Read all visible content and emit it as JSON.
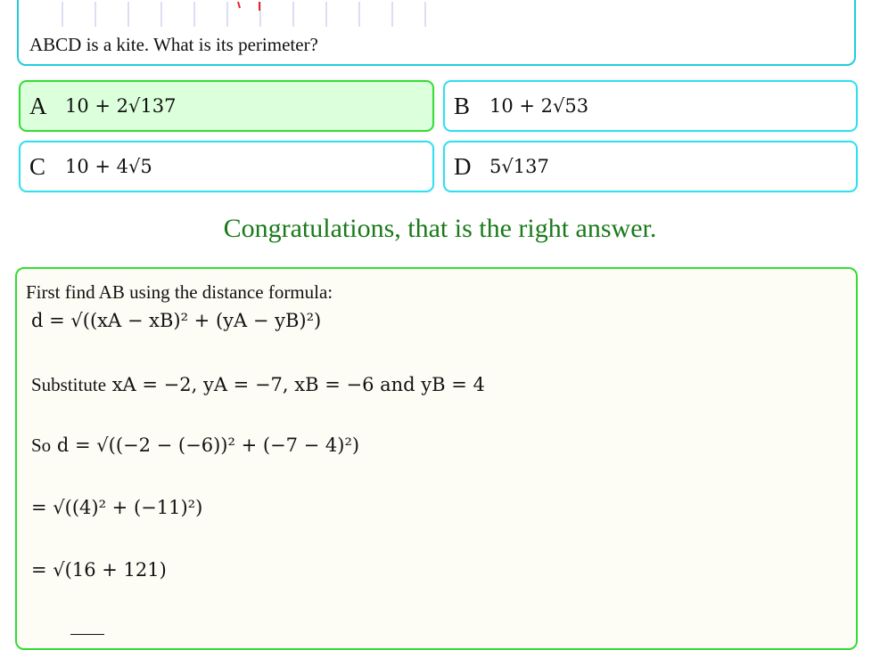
{
  "question": {
    "text": "ABCD is a kite. What is its perimeter?"
  },
  "options": [
    {
      "letter": "A",
      "value": "10 + 2√137",
      "state": "correct"
    },
    {
      "letter": "B",
      "value": "10 + 2√53",
      "state": "normal"
    },
    {
      "letter": "C",
      "value": "10 + 4√5",
      "state": "normal"
    },
    {
      "letter": "D",
      "value": "5√137",
      "state": "normal"
    }
  ],
  "feedback": "Congratulations, that is the right answer.",
  "solution": {
    "intro": "First find AB using the distance formula:",
    "distance_formula": "d = √((xA − xB)² + (yA − yB)²)",
    "substitute_word": "Substitute",
    "substitute": "xA = −2, yA = −7, xB = −6 and yB = 4",
    "so_word": "So",
    "step1": "d = √((−2 − (−6))² + (−7 − 4)²)",
    "step2": "= √((4)² + (−11)²)",
    "step3": "= √(16 + 121)"
  },
  "colors": {
    "question_border": "#22ccdd",
    "option_border": "#2ee0f0",
    "correct_border": "#33dd33",
    "correct_fill": "#dcffdc",
    "feedback_text": "#1a7a1a",
    "solution_border": "#33dd33"
  }
}
